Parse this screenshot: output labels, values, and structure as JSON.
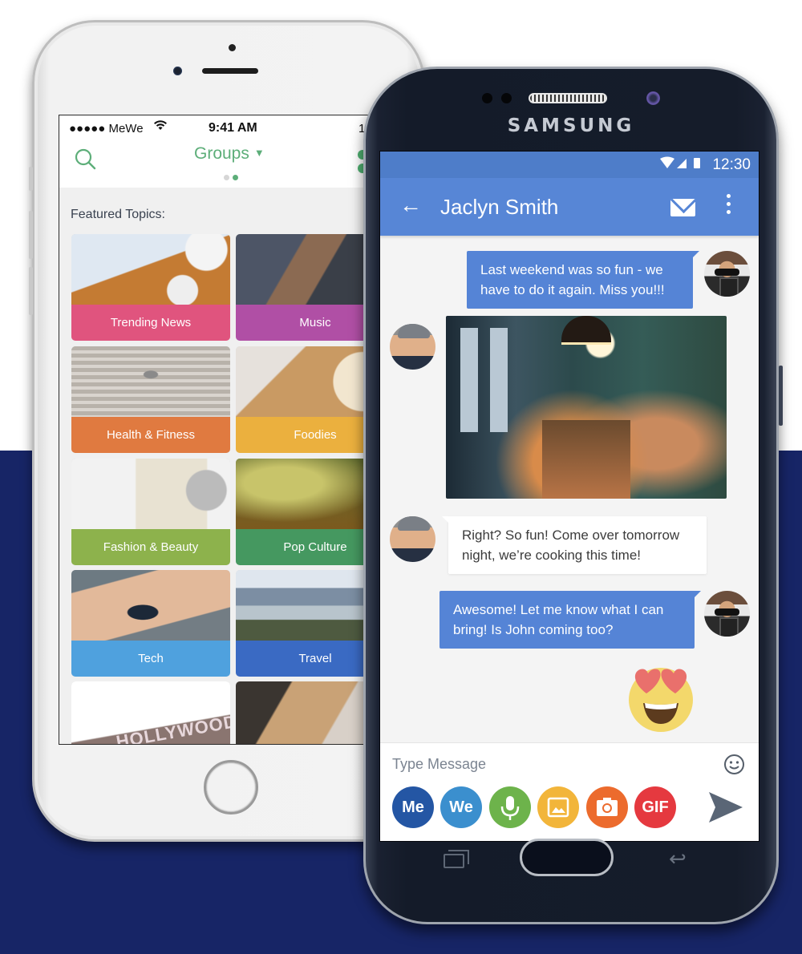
{
  "colors": {
    "background_top": "#ffffff",
    "background_bottom": "#172566",
    "mewe_green": "#5dae79",
    "android_primary": "#5786d6",
    "android_status": "#4e7dc9",
    "outgoing_bubble": "#5584d6",
    "incoming_bubble": "#ffffff"
  },
  "iphone": {
    "status_bar": {
      "carrier": "●●●●● MeWe",
      "wifi_icon": "wifi-icon",
      "time": "9:41 AM",
      "battery": "100%"
    },
    "nav": {
      "search_icon": "search-icon",
      "title": "Groups",
      "title_caret": "▼",
      "page_dots": [
        {
          "active": false,
          "color": "#d6d6d6"
        },
        {
          "active": true,
          "color": "#5dae79"
        }
      ],
      "right_icon": "people-icon"
    },
    "section_label": "Featured Topics:",
    "tiles": [
      {
        "label": "Trending News",
        "color": "#e0547e",
        "photo": "book-and-coffee"
      },
      {
        "label": "Music",
        "color": "#b04fa5",
        "photo": "guitar"
      },
      {
        "label": "Health & Fitness",
        "color": "#e07a40",
        "photo": "stairs-runner"
      },
      {
        "label": "Foodies",
        "color": "#ebb03e",
        "photo": "noodles"
      },
      {
        "label": "Fashion & Beauty",
        "color": "#8db24c",
        "photo": "accessories"
      },
      {
        "label": "Pop Culture",
        "color": "#459860",
        "photo": "concert-mic"
      },
      {
        "label": "Tech",
        "color": "#4fa1de",
        "photo": "smartwatch"
      },
      {
        "label": "Travel",
        "color": "#3a6ac3",
        "photo": "mountains"
      },
      {
        "label": "",
        "color": "",
        "photo": "hollywood-sign",
        "photo_text": "HOLLYWOOD"
      },
      {
        "label": "",
        "color": "",
        "photo": "crafts"
      }
    ]
  },
  "samsung": {
    "brand": "SAMSUNG",
    "status_bar": {
      "icons": "▼◢ ▮",
      "time": "12:30"
    },
    "toolbar": {
      "back_icon": "←",
      "contact_name": "Jaclyn Smith",
      "mail_icon": "mail-icon",
      "more_icon": "more-vert-icon"
    },
    "messages": [
      {
        "direction": "outgoing",
        "type": "text",
        "text": "Last weekend was so fun - we have to do it again. Miss you!!!"
      },
      {
        "direction": "incoming",
        "type": "photo",
        "photo": "restaurant-group"
      },
      {
        "direction": "incoming",
        "type": "text",
        "text": "Right? So fun! Come over tomorrow night, we’re cooking this time!"
      },
      {
        "direction": "outgoing",
        "type": "text",
        "text": "Awesome! Let me know what I can bring! Is John coming too?"
      },
      {
        "direction": "outgoing",
        "type": "emoji",
        "emoji": "heart-eyes-emoji"
      }
    ],
    "composer": {
      "placeholder": "Type Message",
      "value": "",
      "emoji_icon": "smiley-icon",
      "tools": [
        {
          "label": "Me",
          "color": "#2456a4",
          "icon": "me-icon"
        },
        {
          "label": "We",
          "color": "#3b8fce",
          "icon": "we-icon"
        },
        {
          "label": "",
          "color": "#6db34b",
          "icon": "microphone-icon"
        },
        {
          "label": "",
          "color": "#f2b53a",
          "icon": "image-icon"
        },
        {
          "label": "",
          "color": "#ec6b2d",
          "icon": "camera-icon"
        },
        {
          "label": "GIF",
          "color": "#e5393f",
          "icon": "gif-icon"
        }
      ],
      "send_icon": "send-icon"
    },
    "nav_keys": {
      "recent": "recent-apps-icon",
      "home": "home-key",
      "back": "↩"
    }
  }
}
